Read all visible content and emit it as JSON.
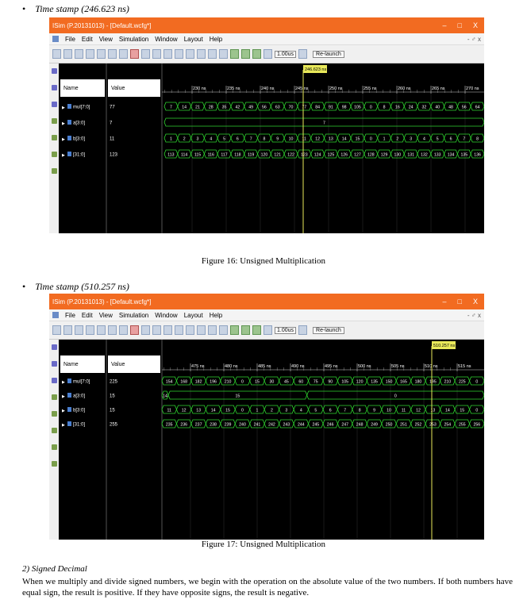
{
  "bullets": [
    {
      "text": "Time stamp (246.623 ns)"
    },
    {
      "text": "Time stamp (510.257 ns)"
    }
  ],
  "captions": [
    "Figure 16: Unsigned Multiplication",
    "Figure 17: Unsigned Multiplication"
  ],
  "window": {
    "title": "ISim (P.20131013) - [Default.wcfg*]",
    "controls": [
      "–",
      "□",
      "X"
    ],
    "doc_controls": "- ♂ x"
  },
  "menu": [
    "File",
    "Edit",
    "View",
    "Simulation",
    "Window",
    "Layout",
    "Help"
  ],
  "toolbar": {
    "run_time": "1.00us",
    "relaunch": "Re-launch"
  },
  "headers": {
    "name": "Name",
    "value": "Value"
  },
  "figures": [
    {
      "cursor": "246.623 ns",
      "ticks": [
        "230 ns",
        "235 ns",
        "240 ns",
        "245 ns",
        "250 ns",
        "255 ns",
        "260 ns",
        "265 ns",
        "270 ns"
      ],
      "signals": [
        {
          "name": "mul[7:0]",
          "value": "77",
          "cells": [
            "7",
            "14",
            "21",
            "28",
            "35",
            "42",
            "49",
            "56",
            "63",
            "70",
            "77",
            "84",
            "91",
            "98",
            "105",
            "0",
            "8",
            "16",
            "24",
            "32",
            "40",
            "48",
            "56",
            "64"
          ]
        },
        {
          "name": "a[3:0]",
          "value": "7",
          "cells": [
            "7"
          ]
        },
        {
          "name": "b[3:0]",
          "value": "11",
          "cells": [
            "1",
            "2",
            "3",
            "4",
            "5",
            "6",
            "7",
            "8",
            "9",
            "10",
            "11",
            "12",
            "13",
            "14",
            "15",
            "0",
            "1",
            "2",
            "3",
            "4",
            "5",
            "6",
            "7",
            "8"
          ]
        },
        {
          "name": "[31:0]",
          "value": "123",
          "cells": [
            "113",
            "114",
            "115",
            "116",
            "117",
            "118",
            "119",
            "120",
            "121",
            "122",
            "123",
            "124",
            "125",
            "126",
            "127",
            "128",
            "129",
            "130",
            "131",
            "132",
            "133",
            "134",
            "135",
            "136"
          ]
        }
      ]
    },
    {
      "cursor": "510.257 ns",
      "ticks": [
        "475 ns",
        "480 ns",
        "485 ns",
        "490 ns",
        "495 ns",
        "500 ns",
        "505 ns",
        "510 ns",
        "515 ns"
      ],
      "signals": [
        {
          "name": "mul[7:0]",
          "value": "225",
          "cells": [
            "154",
            "168",
            "182",
            "196",
            "210",
            "0",
            "15",
            "30",
            "45",
            "60",
            "75",
            "90",
            "105",
            "120",
            "135",
            "150",
            "165",
            "180",
            "195",
            "210",
            "225",
            "0"
          ]
        },
        {
          "name": "a[3:0]",
          "value": "15",
          "cells": [
            "14",
            "15",
            "0"
          ]
        },
        {
          "name": "b[3:0]",
          "value": "15",
          "cells": [
            "11",
            "12",
            "13",
            "14",
            "15",
            "0",
            "1",
            "2",
            "3",
            "4",
            "5",
            "6",
            "7",
            "8",
            "9",
            "10",
            "11",
            "12",
            "13",
            "14",
            "15",
            "0"
          ]
        },
        {
          "name": "[31:0]",
          "value": "255",
          "cells": [
            "235",
            "236",
            "237",
            "238",
            "239",
            "240",
            "241",
            "242",
            "243",
            "244",
            "245",
            "246",
            "247",
            "248",
            "249",
            "250",
            "251",
            "252",
            "253",
            "254",
            "255",
            "256"
          ]
        }
      ]
    }
  ],
  "section": {
    "title": "2)   Signed Decimal",
    "para": "When we multiply and divide signed numbers, we begin with the operation on the absolute value of the two numbers. If both numbers have equal sign, the result is positive. If they have opposite signs, the result is negative."
  }
}
